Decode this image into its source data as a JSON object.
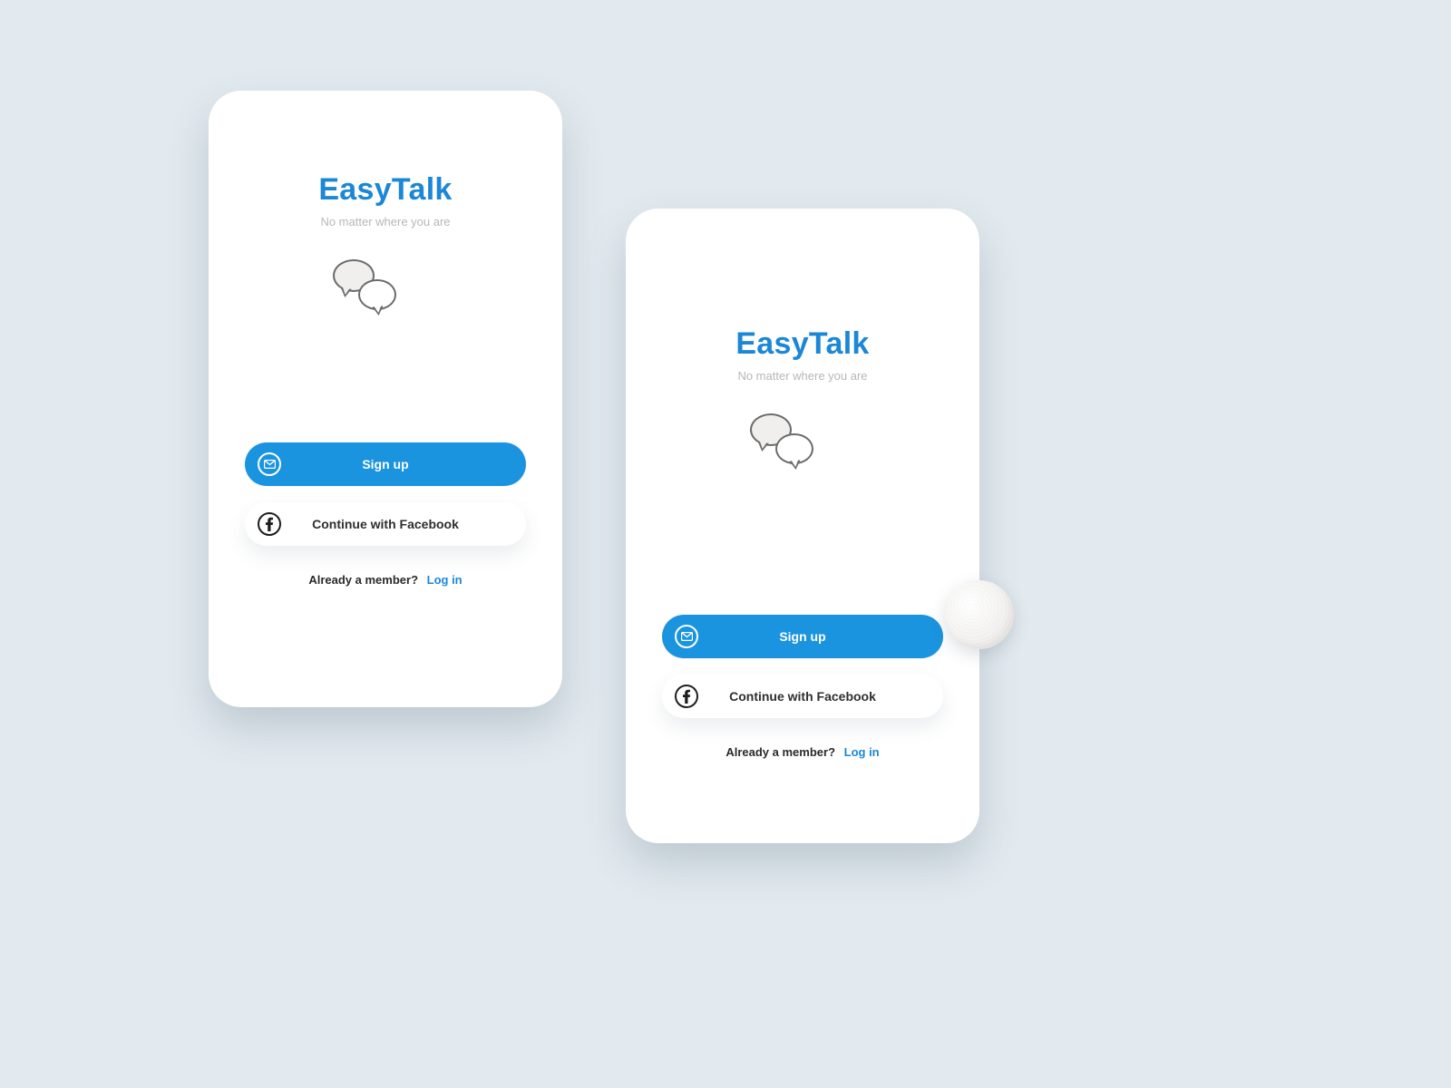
{
  "brand": {
    "title": "EasyTalk",
    "tagline": "No matter where you are"
  },
  "actions": {
    "signup_label": "Sign up",
    "facebook_label": "Continue with Facebook",
    "signup_icon": "envelope-icon",
    "facebook_icon": "facebook-icon"
  },
  "login": {
    "prompt": "Already a member?",
    "link_label": "Log in"
  },
  "colors": {
    "brand_blue": "#1b87d6",
    "button_blue": "#1b94e0",
    "page_bg": "#e2eaef"
  }
}
